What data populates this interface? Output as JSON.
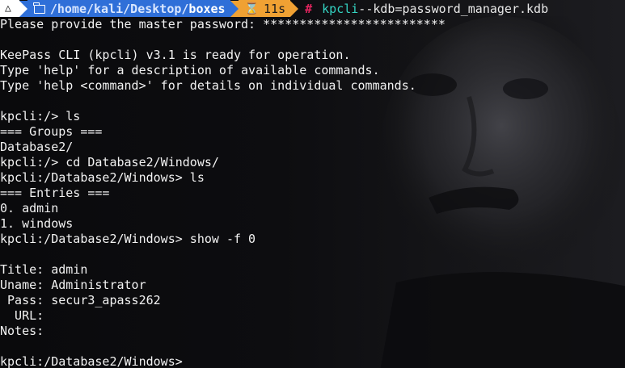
{
  "prompt": {
    "os_icon": "tux-icon",
    "folder_icon": "folder-icon",
    "path_prefix": "/home/kali/Desktop/",
    "path_current": "boxes",
    "time_icon": "hourglass-icon",
    "elapsed": "11s",
    "hash": "#",
    "command_name": "kpcli",
    "command_args": " --kdb=password_manager.kdb"
  },
  "lines": [
    "Please provide the master password: *************************",
    "",
    "KeePass CLI (kpcli) v3.1 is ready for operation.",
    "Type 'help' for a description of available commands.",
    "Type 'help <command>' for details on individual commands.",
    "",
    "kpcli:/> ls",
    "=== Groups ===",
    "Database2/",
    "kpcli:/> cd Database2/Windows/",
    "kpcli:/Database2/Windows> ls",
    "=== Entries ===",
    "0. admin",
    "1. windows",
    "kpcli:/Database2/Windows> show -f 0",
    "",
    "Title: admin",
    "Uname: Administrator",
    " Pass: secur3_apass262",
    "  URL:",
    "Notes:",
    "",
    "kpcli:/Database2/Windows>"
  ],
  "colors": {
    "path_segment": "#2f6fd8",
    "time_segment": "#f0a133",
    "hash": "#e0245e",
    "command": "#34d3c2"
  }
}
